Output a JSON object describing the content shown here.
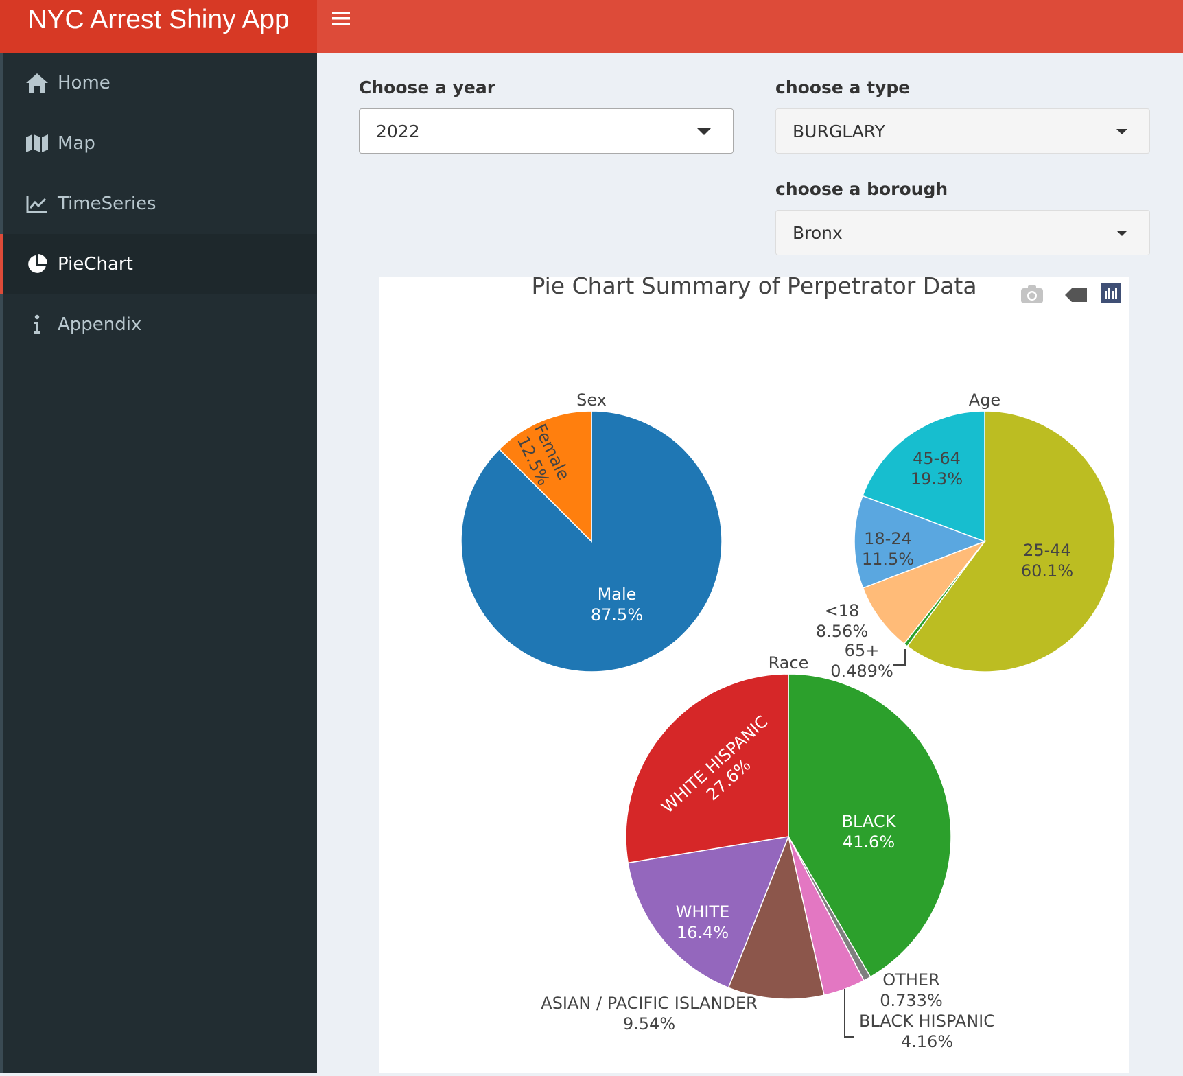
{
  "app": {
    "title": "NYC Arrest Shiny App"
  },
  "sidebar": {
    "items": [
      {
        "label": "Home",
        "icon": "home-icon"
      },
      {
        "label": "Map",
        "icon": "map-icon"
      },
      {
        "label": "TimeSeries",
        "icon": "line-chart-icon"
      },
      {
        "label": "PieChart",
        "icon": "pie-chart-icon",
        "active": true
      },
      {
        "label": "Appendix",
        "icon": "info-icon"
      }
    ]
  },
  "controls": {
    "year": {
      "label": "Choose a year",
      "value": "2022"
    },
    "type": {
      "label": "choose a type",
      "value": "BURGLARY"
    },
    "borough": {
      "label": "choose a borough",
      "value": "Bronx"
    }
  },
  "colors": {
    "header": "#dd4b39",
    "logo": "#d73925",
    "sidebar": "#222d32"
  },
  "chart_data": {
    "type": "pie",
    "title": "Pie Chart Summary of Perpetrator Data",
    "pies": [
      {
        "name": "Sex",
        "slices": [
          {
            "label": "Male",
            "value": 87.5,
            "text": "87.5%",
            "color": "#1f77b4"
          },
          {
            "label": "Female",
            "value": 12.5,
            "text": "12.5%",
            "color": "#ff7f0e"
          }
        ]
      },
      {
        "name": "Age",
        "slices": [
          {
            "label": "25-44",
            "value": 60.1,
            "text": "60.1%",
            "color": "#bcbd22"
          },
          {
            "label": "65+",
            "value": 0.489,
            "text": "0.489%",
            "color": "#2ca02c"
          },
          {
            "label": "<18",
            "value": 8.56,
            "text": "8.56%",
            "color": "#ffbb78"
          },
          {
            "label": "18-24",
            "value": 11.5,
            "text": "11.5%",
            "color": "#5aa7e0"
          },
          {
            "label": "45-64",
            "value": 19.3,
            "text": "19.3%",
            "color": "#17becf"
          }
        ]
      },
      {
        "name": "Race",
        "slices": [
          {
            "label": "BLACK",
            "value": 41.6,
            "text": "41.6%",
            "color": "#2ca02c"
          },
          {
            "label": "OTHER",
            "value": 0.733,
            "text": "0.733%",
            "color": "#7f7f7f"
          },
          {
            "label": "BLACK HISPANIC",
            "value": 4.16,
            "text": "4.16%",
            "color": "#e377c2"
          },
          {
            "label": "ASIAN / PACIFIC ISLANDER",
            "value": 9.54,
            "text": "9.54%",
            "color": "#8c564b"
          },
          {
            "label": "WHITE",
            "value": 16.4,
            "text": "16.4%",
            "color": "#9467bd"
          },
          {
            "label": "WHITE HISPANIC",
            "value": 27.6,
            "text": "27.6%",
            "color": "#d62728"
          }
        ]
      }
    ]
  }
}
